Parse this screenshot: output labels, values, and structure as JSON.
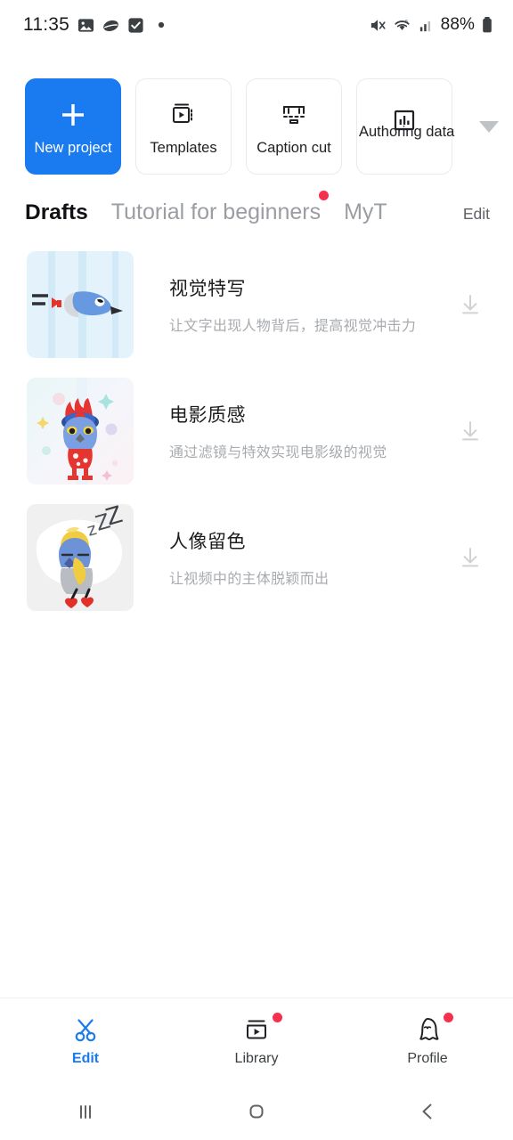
{
  "status_bar": {
    "time": "11:35",
    "battery_percent": "88%",
    "left_icons": [
      "photos-icon",
      "leaf-icon",
      "checkbox-icon",
      "dot-icon"
    ],
    "right_icons": [
      "mute-icon",
      "wifi-icon",
      "signal-icon",
      "battery-icon"
    ]
  },
  "quick_actions": {
    "items": [
      {
        "label": "New project",
        "icon": "plus-icon",
        "primary": true
      },
      {
        "label": "Templates",
        "icon": "video-template-icon",
        "primary": false
      },
      {
        "label": "Caption cut",
        "icon": "caption-cut-icon",
        "primary": false
      },
      {
        "label": "Authoring data",
        "icon": "bar-chart-icon",
        "primary": false
      }
    ],
    "expand_icon": "chevron-down-icon"
  },
  "tabs": {
    "items": [
      {
        "label": "Drafts",
        "active": true,
        "badge": false
      },
      {
        "label": "Tutorial for beginners",
        "active": false,
        "badge": true
      },
      {
        "label": "MyT",
        "active": false,
        "badge": false
      }
    ],
    "edit_label": "Edit"
  },
  "drafts": [
    {
      "title": "视觉特写",
      "description": "让文字出现人物背后，提高视觉冲击力",
      "thumbnail": "flying-bird-thumbnail",
      "action_icon": "download-icon"
    },
    {
      "title": "电影质感",
      "description": "通过滤镜与特效实现电影级的视觉",
      "thumbnail": "jester-owl-thumbnail",
      "action_icon": "download-icon"
    },
    {
      "title": "人像留色",
      "description": "让视频中的主体脱颖而出",
      "thumbnail": "sleeping-bird-thumbnail",
      "action_icon": "download-icon"
    }
  ],
  "bottom_nav": {
    "items": [
      {
        "label": "Edit",
        "icon": "scissors-icon",
        "active": true,
        "badge": false
      },
      {
        "label": "Library",
        "icon": "media-library-icon",
        "active": false,
        "badge": true
      },
      {
        "label": "Profile",
        "icon": "ghost-avatar-icon",
        "active": false,
        "badge": true
      }
    ]
  },
  "android_nav": {
    "recents_icon": "recents-icon",
    "home_icon": "home-icon",
    "back_icon": "back-icon"
  },
  "colors": {
    "accent": "#1a7bf0",
    "badge": "#f5304f",
    "text_primary": "#1d1d1f",
    "text_muted": "#a8abaf"
  }
}
